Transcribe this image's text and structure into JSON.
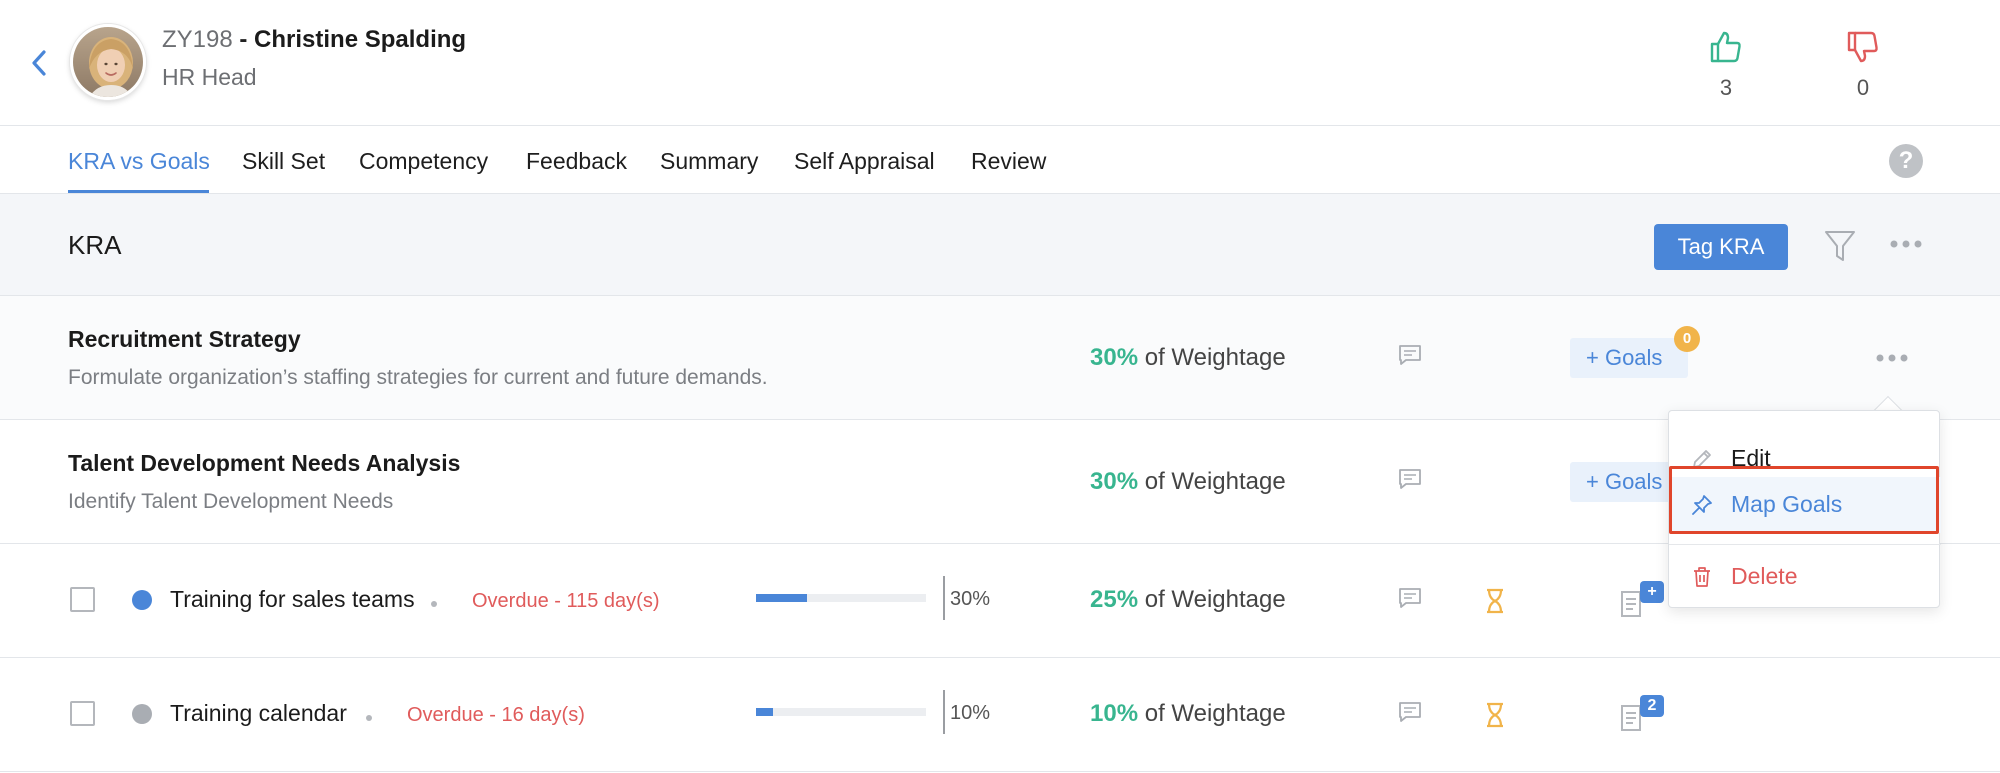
{
  "header": {
    "employee_id": "ZY198",
    "separator": " - ",
    "employee_name": "Christine Spalding",
    "role": "HR Head",
    "likes": "3",
    "dislikes": "0"
  },
  "tabs": [
    {
      "label": "KRA vs Goals"
    },
    {
      "label": "Skill Set"
    },
    {
      "label": "Competency"
    },
    {
      "label": "Feedback"
    },
    {
      "label": "Summary"
    },
    {
      "label": "Self Appraisal"
    },
    {
      "label": "Review"
    }
  ],
  "help_label": "?",
  "kra_bar": {
    "title": "KRA",
    "tag_button": "Tag KRA"
  },
  "weightage_suffix": " of Weightage",
  "goals_button": "+ Goals",
  "kras": [
    {
      "name": "Recruitment Strategy",
      "description": "Formulate organization’s staffing strategies for current and future demands.",
      "weightage": "30%",
      "goals_count": "0"
    },
    {
      "name": "Talent Development Needs Analysis",
      "description": "Identify Talent Development Needs",
      "weightage": "30%"
    }
  ],
  "goals": [
    {
      "name": "Training for sales teams",
      "status_color": "#4a86d8",
      "overdue": "Overdue - 115 day(s)",
      "progress_label": "30%",
      "progress": 0.3,
      "weightage": "25%",
      "doc_badge": "+"
    },
    {
      "name": "Training calendar",
      "status_color": "#a9adb3",
      "overdue": "Overdue - 16 day(s)",
      "progress_label": "10%",
      "progress": 0.1,
      "weightage": "10%",
      "doc_badge": "2"
    }
  ],
  "menu": {
    "edit": "Edit",
    "map_goals": "Map Goals",
    "delete": "Delete"
  },
  "colors": {
    "accent": "#4a86d8",
    "weightage": "#38b58f",
    "overdue": "#e05b5b",
    "badge": "#f1b44a",
    "highlight": "#e0452b"
  }
}
